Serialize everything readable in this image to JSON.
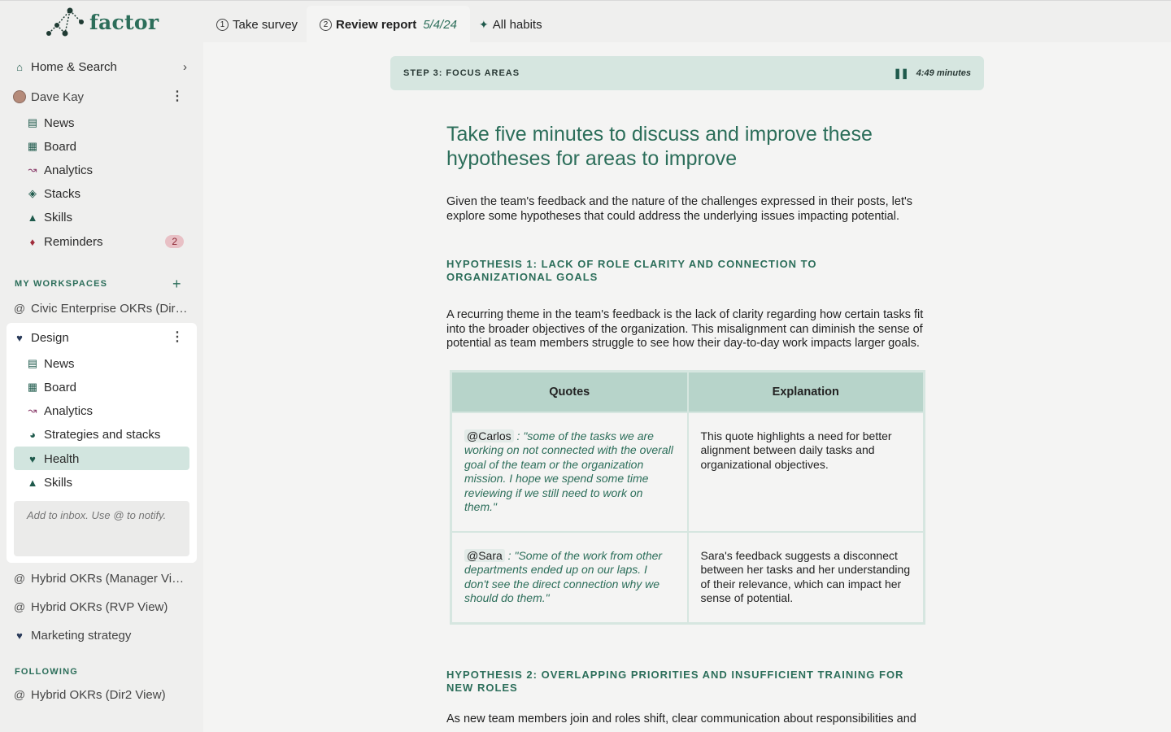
{
  "brand": {
    "name": "factor",
    "color": "#2c6e5a"
  },
  "sidebar": {
    "home": {
      "label": "Home & Search",
      "icon": "home-search-icon"
    },
    "user": {
      "name": "Dave Kay"
    },
    "user_items": [
      {
        "label": "News",
        "icon": "news-icon"
      },
      {
        "label": "Board",
        "icon": "board-icon"
      },
      {
        "label": "Analytics",
        "icon": "analytics-icon"
      },
      {
        "label": "Stacks",
        "icon": "stacks-icon"
      },
      {
        "label": "Skills",
        "icon": "skills-icon"
      },
      {
        "label": "Reminders",
        "icon": "bell-icon",
        "badge": "2"
      }
    ],
    "workspaces_label": "MY WORKSPACES",
    "workspace_1": "Civic Enterprise OKRs (Dire...",
    "design": {
      "label": "Design",
      "items": [
        {
          "label": "News"
        },
        {
          "label": "Board"
        },
        {
          "label": "Analytics"
        },
        {
          "label": "Strategies and stacks"
        },
        {
          "label": "Health",
          "active": true
        },
        {
          "label": "Skills"
        }
      ],
      "inbox_placeholder": "Add to inbox. Use @ to notify."
    },
    "workspaces_more": [
      "Hybrid OKRs (Manager View)",
      "Hybrid OKRs (RVP View)",
      "Marketing strategy"
    ],
    "following_label": "FOLLOWING",
    "following": [
      "Hybrid OKRs (Dir2 View)"
    ]
  },
  "tabs": [
    {
      "num": "1",
      "label": "Take survey"
    },
    {
      "num": "2",
      "label": "Review report",
      "date": "5/4/24",
      "active": true
    },
    {
      "label": "All habits"
    }
  ],
  "step": {
    "label": "STEP 3: FOCUS AREAS",
    "timer": "4:49",
    "timer_unit": "minutes"
  },
  "main": {
    "title": "Take five minutes to discuss and improve these hypotheses for areas to improve",
    "intro": "Given the team's feedback and the nature of the challenges expressed in their posts, let's explore some hypotheses that could address the underlying issues impacting potential.",
    "h1": "HYPOTHESIS 1: LACK OF ROLE CLARITY AND CONNECTION TO ORGANIZATIONAL GOALS",
    "h1_body": "A recurring theme in the team's feedback is the lack of clarity regarding how certain tasks fit into the broader objectives of the organization. This misalignment can diminish the sense of potential as team members struggle to see how their day-to-day work impacts larger goals.",
    "table": {
      "headers": [
        "Quotes",
        "Explanation"
      ],
      "rows": [
        {
          "mention": "@Carlos",
          "quote": "\"some of the tasks we are working on not connected with the overall goal of the team or the organization mission. I hope we spend some time reviewing if we still need to work on them.\"",
          "explanation": "This quote highlights a need for better alignment between daily tasks and organizational objectives."
        },
        {
          "mention": "@Sara",
          "quote": "\"Some of the work from other departments ended up on our laps. I don't see the direct connection why we should do them.\"",
          "explanation": "Sara's feedback suggests a disconnect between her tasks and her understanding of their relevance, which can impact her sense of potential."
        }
      ]
    },
    "h2": "HYPOTHESIS 2: OVERLAPPING PRIORITIES AND INSUFFICIENT TRAINING FOR NEW ROLES",
    "h2_body": "As new team members join and roles shift, clear communication about responsibilities and"
  }
}
